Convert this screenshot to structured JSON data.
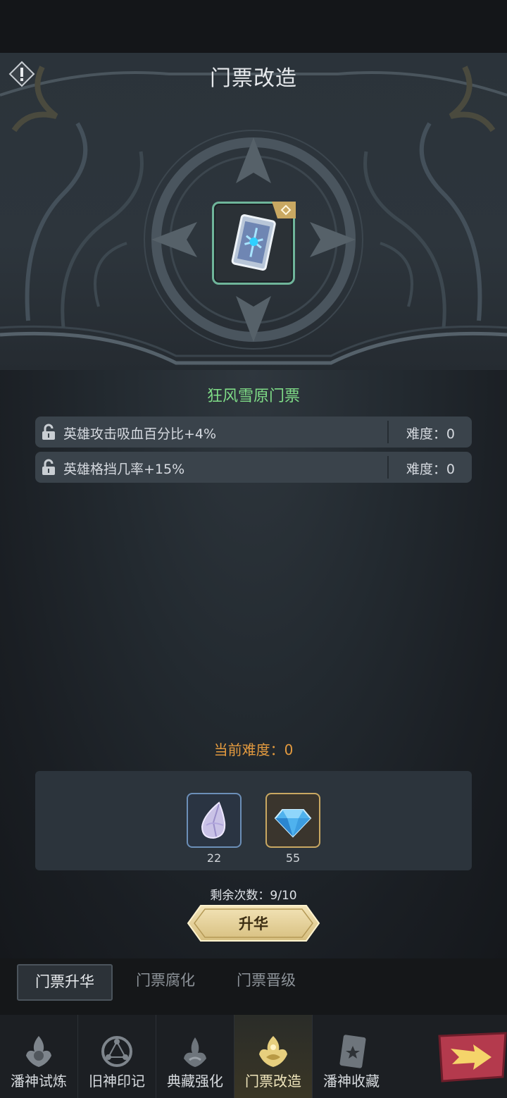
{
  "header": {
    "title": "门票改造",
    "info_icon": "exclamation-icon"
  },
  "item": {
    "name": "狂风雪原门票",
    "frame_color": "#6fb59a",
    "badge_icon": "diamond-badge-icon",
    "name_color": "#7fdc87"
  },
  "attributes": [
    {
      "text": "英雄攻击吸血百分比+4%",
      "difficulty": "难度：0",
      "icon": "unlock-icon"
    },
    {
      "text": "英雄格挡几率+15%",
      "difficulty": "难度：0",
      "icon": "unlock-icon"
    }
  ],
  "current_difficulty": "当前难度：0",
  "costs": [
    {
      "icon": "crystal-shard-icon",
      "count": "22"
    },
    {
      "icon": "diamond-gem-icon",
      "count": "55"
    }
  ],
  "remaining": "剩余次数：9/10",
  "ascend_button": "升华",
  "subtabs": [
    {
      "label": "门票升华",
      "active": true
    },
    {
      "label": "门票腐化",
      "active": false
    },
    {
      "label": "门票晋级",
      "active": false
    }
  ],
  "bottom_nav": [
    {
      "label": "潘神试炼",
      "icon": "flame-crest-icon",
      "active": false
    },
    {
      "label": "旧神印记",
      "icon": "rune-circle-icon",
      "active": false
    },
    {
      "label": "典藏强化",
      "icon": "horn-crest-icon",
      "active": false
    },
    {
      "label": "门票改造",
      "icon": "gold-crest-icon",
      "active": true
    },
    {
      "label": "潘神收藏",
      "icon": "star-card-icon",
      "active": false
    }
  ],
  "next_icon": "arrow-right-icon",
  "colors": {
    "accent_gold": "#d9c27e",
    "difficulty_orange": "#e39a3f",
    "green": "#7fdc87"
  }
}
